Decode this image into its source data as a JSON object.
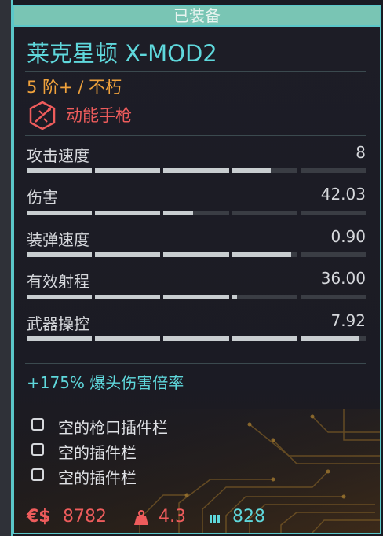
{
  "header": {
    "label": "已装备"
  },
  "weapon": {
    "name": "莱克星顿 X-MOD2",
    "tier": "5 阶+ / 不朽",
    "type": "动能手枪",
    "type_icon": "power-weapon-icon"
  },
  "stats": [
    {
      "label": "攻击速度",
      "value": "8",
      "fill": 0.72
    },
    {
      "label": "伤害",
      "value": "42.03",
      "fill": 0.49
    },
    {
      "label": "装弹速度",
      "value": "0.90",
      "fill": 0.78
    },
    {
      "label": "有效射程",
      "value": "36.00",
      "fill": 0.62
    },
    {
      "label": "武器操控",
      "value": "7.92",
      "fill": 0.98
    }
  ],
  "perk": "+175% 爆头伤害倍率",
  "slots": [
    {
      "label": "空的枪口插件栏"
    },
    {
      "label": "空的插件栏"
    },
    {
      "label": "空的插件栏"
    }
  ],
  "footer": {
    "currency_symbol": "€$",
    "price": "8782",
    "weight_icon": "weight-icon",
    "weight": "4.3",
    "ammo_icon": "ammo-icon",
    "ammo": "828"
  },
  "colors": {
    "accent": "#5fd8dc",
    "tier": "#f0a23c",
    "type": "#ee5c5c",
    "footer": "#ee5c5c"
  }
}
